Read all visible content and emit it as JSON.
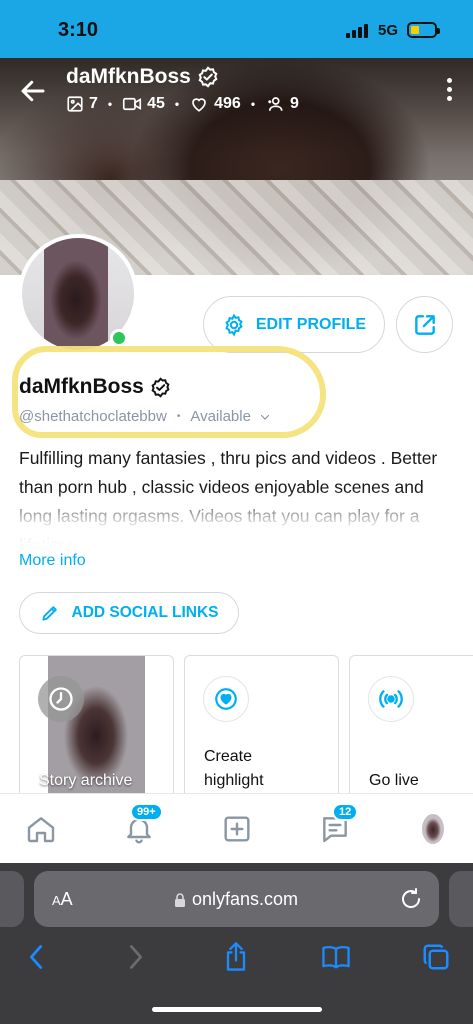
{
  "status_bar": {
    "time": "3:10",
    "network": "5G"
  },
  "cover": {
    "name": "daMfknBoss",
    "stats": [
      {
        "icon": "image-icon",
        "value": "7"
      },
      {
        "icon": "video-icon",
        "value": "45"
      },
      {
        "icon": "heart-icon",
        "value": "496"
      },
      {
        "icon": "fans-icon",
        "value": "9"
      }
    ]
  },
  "profile": {
    "edit_label": "EDIT PROFILE",
    "display_name": "daMfknBoss",
    "handle": "@shethatchoclatebbw",
    "availability": "Available",
    "bio": "Fulfilling many fantasies , thru pics and videos . Better than porn hub , classic videos enjoyable scenes and long lasting orgasms. Videos that you can play for a lifetime",
    "more_info": "More info",
    "social_links_label": "ADD SOCIAL LINKS"
  },
  "cards": [
    {
      "label": "Story archive",
      "icon": "clock-icon"
    },
    {
      "label": "Create highlight",
      "icon": "heart-circle-icon"
    },
    {
      "label": "Go live",
      "icon": "broadcast-icon"
    }
  ],
  "bottom_nav": {
    "notifications_badge": "99+",
    "messages_badge": "12"
  },
  "safari": {
    "aa_label_small": "A",
    "aa_label_large": "A",
    "url": "onlyfans.com"
  },
  "colors": {
    "accent": "#00aff0",
    "status_bar": "#1ba7e6",
    "online": "#2ec65b",
    "highlighter": "#f6e27a"
  }
}
